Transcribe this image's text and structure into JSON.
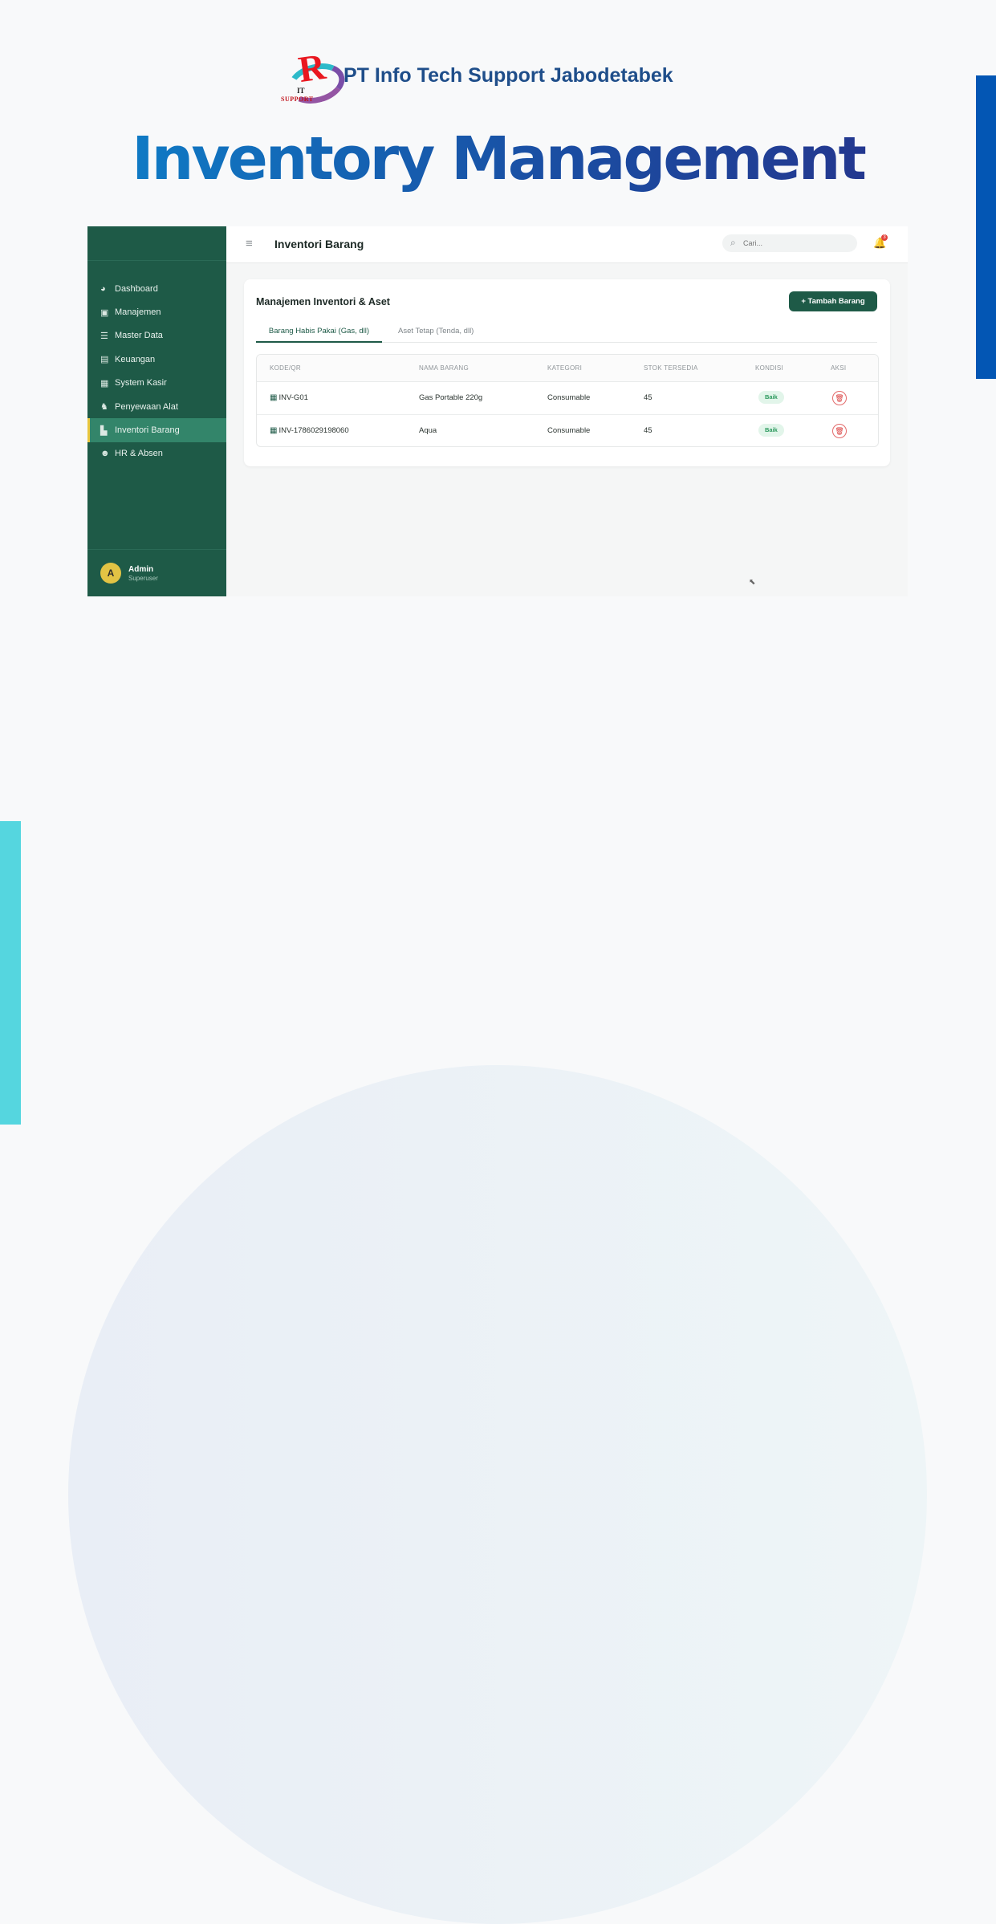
{
  "brand": {
    "company_name": "PT Info Tech Support Jabodetabek",
    "logo_letter": "R",
    "logo_text_top": "IT",
    "logo_text_bottom": "SUPPORT"
  },
  "headline": "Inventory Management",
  "colors": {
    "sidebar": "#1e5a47",
    "sidebar_active": "#33856a",
    "accent_yellow": "#e8c63e",
    "accent_blue": "#0356b4",
    "accent_cyan": "#55d6df"
  },
  "sidebar": {
    "items": [
      {
        "label": "Dashboard",
        "icon": "pie-chart-icon"
      },
      {
        "label": "Manajemen",
        "icon": "clipboard-icon"
      },
      {
        "label": "Master Data",
        "icon": "database-icon"
      },
      {
        "label": "Keuangan",
        "icon": "wallet-icon"
      },
      {
        "label": "System Kasir",
        "icon": "cash-register-icon"
      },
      {
        "label": "Penyewaan Alat",
        "icon": "hiking-icon"
      },
      {
        "label": "Inventori Barang",
        "icon": "boxes-icon",
        "active": true
      },
      {
        "label": "HR & Absen",
        "icon": "users-icon"
      }
    ],
    "user": {
      "initial": "A",
      "name": "Admin",
      "role": "Superuser"
    }
  },
  "topbar": {
    "title": "Inventori Barang",
    "search_placeholder": "Cari...",
    "notification_count": "3"
  },
  "main": {
    "card_title": "Manajemen Inventori & Aset",
    "add_button": "+ Tambah Barang",
    "tabs": [
      {
        "label": "Barang Habis Pakai (Gas, dll)",
        "active": true
      },
      {
        "label": "Aset Tetap (Tenda, dll)",
        "active": false
      }
    ],
    "table": {
      "columns": [
        "KODE/QR",
        "NAMA BARANG",
        "KATEGORI",
        "STOK TERSEDIA",
        "KONDISI",
        "AKSI"
      ],
      "rows": [
        {
          "kode": "INV-G01",
          "nama": "Gas Portable 220g",
          "kategori": "Consumable",
          "stok": "45",
          "kondisi": "Baik"
        },
        {
          "kode": "INV-1786029198060",
          "nama": "Aqua",
          "kategori": "Consumable",
          "stok": "45",
          "kondisi": "Baik"
        }
      ]
    }
  }
}
